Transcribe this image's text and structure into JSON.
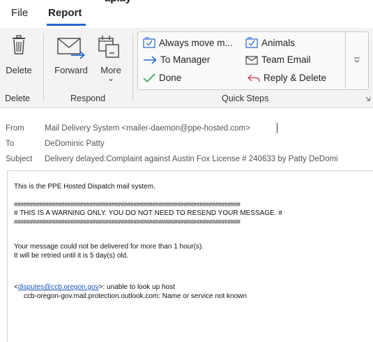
{
  "window": {
    "title_fragment": "aplay"
  },
  "menu": {
    "file": "File",
    "report": "Report"
  },
  "ribbon": {
    "delete_button": "Delete",
    "forward_button": "Forward",
    "more_button": "More",
    "more_chevron": "⌄",
    "group_delete": "Delete",
    "group_respond": "Respond",
    "group_quick_steps": "Quick Steps",
    "quick_steps": {
      "always_move": "Always move m...",
      "animals": "Animals",
      "to_manager": "To Manager",
      "team_email": "Team Email",
      "done": "Done",
      "reply_delete": "Reply & Delete"
    }
  },
  "header": {
    "from_label": "From",
    "from_value": "Mail Delivery System <mailer-daemon@ppe-hosted.com>",
    "to_label": "To",
    "to_value": "DeDominic Patty",
    "subject_label": "Subject",
    "subject_value": "Delivery delayed:Complaint against Austin Fox License # 240633 by Patty DeDomi"
  },
  "body": {
    "line1": "This is the PPE Hosted Dispatch mail system.",
    "hash_line": "########################################################################",
    "warning": "# THIS IS A WARNING ONLY.  YOU DO NOT NEED TO RESEND YOUR MESSAGE. #",
    "not_delivered": "Your message could not be delivered for more than 1 hour(s).",
    "retry": "It will be retried until it is 5 day(s) old.",
    "addr_open": "<",
    "addr_link": "disputes@ccb.oregon.gov",
    "addr_close": ">: unable to look up host",
    "host_error": "ccb-oregon-gov.mail.protection.outlook.com: Name or service not known"
  },
  "colors": {
    "accent": "#2266cc",
    "done_check": "#3aa35a",
    "reply_arrow": "#d04b5f"
  }
}
